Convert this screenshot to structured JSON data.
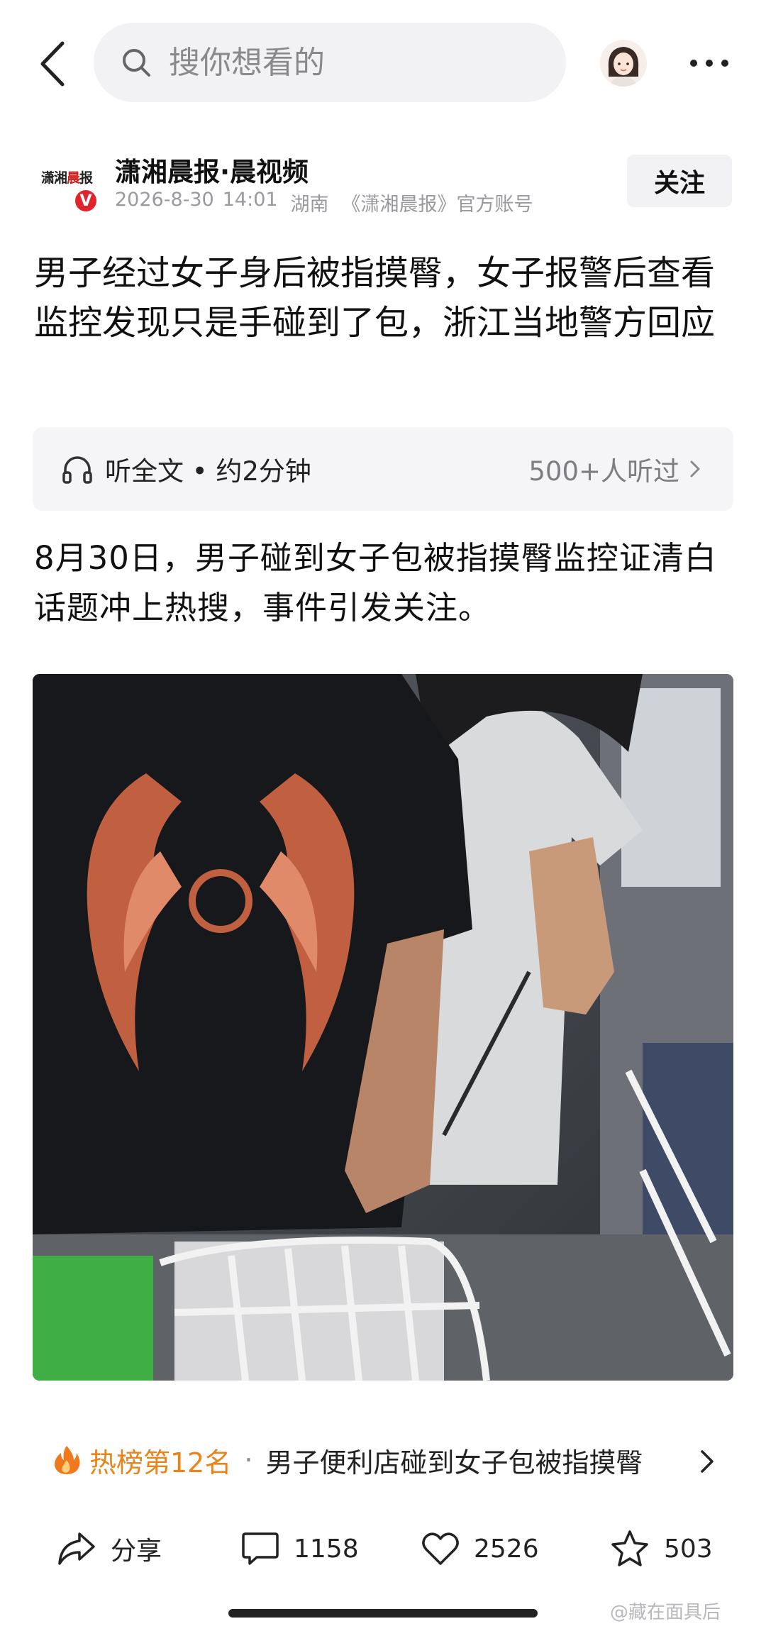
{
  "search": {
    "placeholder": "搜你想看的"
  },
  "author": {
    "logo_text_a": "潇湘",
    "logo_text_b": "晨",
    "logo_text_c": "报",
    "verify_mark": "V",
    "name": "潇湘晨报·晨视频",
    "date": "2026-8-30",
    "time": "14:01",
    "location": "湖南",
    "account_type": "《潇湘晨报》官方账号",
    "follow_label": "关注"
  },
  "article": {
    "title": "男子经过女子身后被指摸臀，女子报警后查看监控发现只是手碰到了包，浙江当地警方回应",
    "body": "8月30日，男子碰到女子包被指摸臀监控证清白话题冲上热搜，事件引发关注。"
  },
  "listen": {
    "label": "听全文 • 约2分钟",
    "count": "500+人听过"
  },
  "hot_rank": {
    "label": "热榜第12名",
    "separator": "·",
    "topic": "男子便利店碰到女子包被指摸臀"
  },
  "actions": {
    "share": "分享",
    "comments": "1158",
    "likes": "2526",
    "favorites": "503"
  },
  "watermark": "@藏在面具后",
  "colors": {
    "hot_rank_orange": "#e8841a",
    "verify_red": "#e1252c",
    "search_bg": "#f2f2f4"
  }
}
